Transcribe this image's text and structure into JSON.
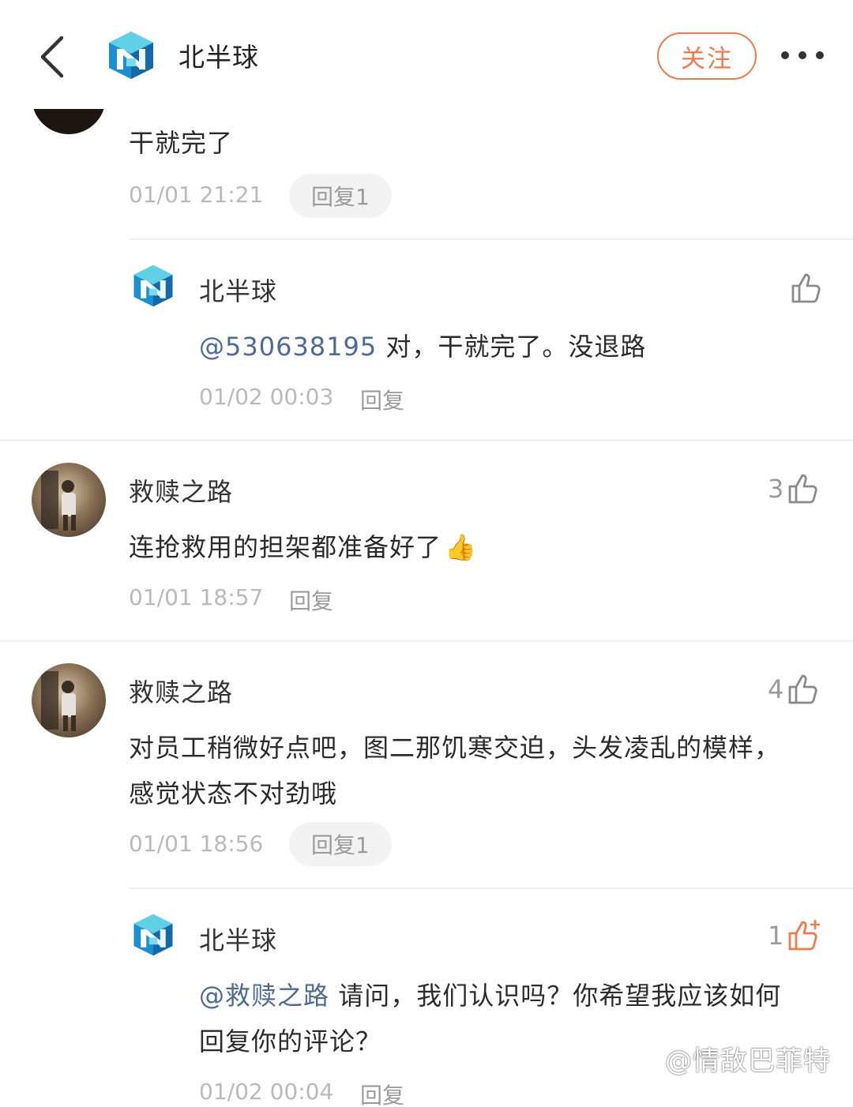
{
  "header": {
    "title": "北半球",
    "follow_label": "关注"
  },
  "comments": [
    {
      "text": "干就完了",
      "time": "01/01 21:21",
      "reply_label": "回复1",
      "replies": [
        {
          "name": "北半球",
          "mention": "@530638195",
          "text": " 对，干就完了。没退路",
          "time": "01/02 00:03",
          "reply_label": "回复"
        }
      ]
    },
    {
      "name": "救赎之路",
      "likes": "3",
      "text": "连抢救用的担架都准备好了",
      "emoji": "👍",
      "time": "01/01 18:57",
      "reply_label": "回复"
    },
    {
      "name": "救赎之路",
      "likes": "4",
      "text_line1": "对员工稍微好点吧，图二那饥寒交迫，头发凌乱的模样，",
      "text_line2": "感觉状态不对劲哦",
      "time": "01/01 18:56",
      "reply_label": "回复1",
      "replies": [
        {
          "name": "北半球",
          "likes": "1",
          "mention": "@救赎之路",
          "text_line1": " 请问，我们认识吗？你希望我应该如何",
          "text_line2": "回复你的评论？",
          "time": "01/02 00:04",
          "reply_label": "回复"
        }
      ]
    }
  ],
  "watermark": "@情敌巴菲特",
  "colors": {
    "accent": "#f07a4e",
    "mention": "#4d6a96",
    "liked": "#f07a4e"
  },
  "icons": [
    "back-arrow-icon",
    "more-dots-icon",
    "thumb-up-icon",
    "thumb-up-plus-icon",
    "weibo-logo-icon"
  ]
}
